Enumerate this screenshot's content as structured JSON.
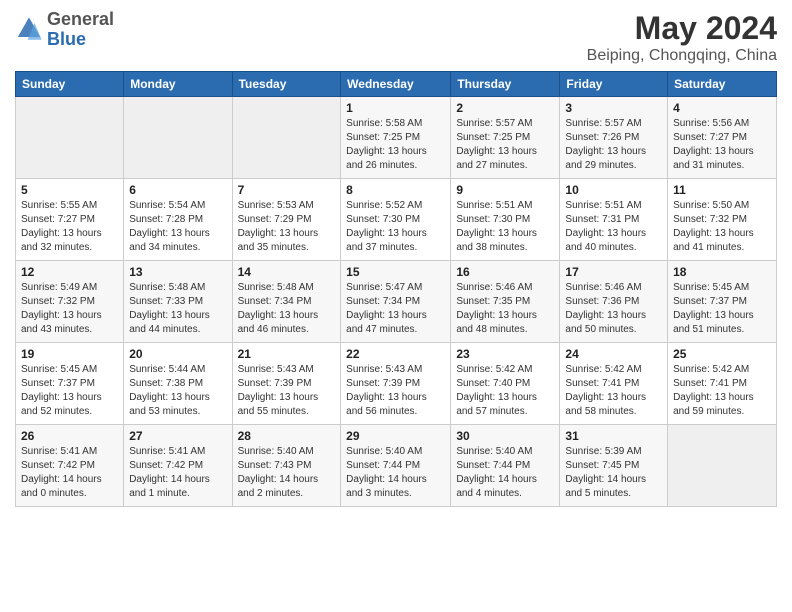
{
  "header": {
    "logo_line1": "General",
    "logo_line2": "Blue",
    "main_title": "May 2024",
    "subtitle": "Beiping, Chongqing, China"
  },
  "days_of_week": [
    "Sunday",
    "Monday",
    "Tuesday",
    "Wednesday",
    "Thursday",
    "Friday",
    "Saturday"
  ],
  "weeks": [
    [
      {
        "day": "",
        "empty": true
      },
      {
        "day": "",
        "empty": true
      },
      {
        "day": "",
        "empty": true
      },
      {
        "day": "1",
        "sunrise": "5:58 AM",
        "sunset": "7:25 PM",
        "daylight": "13 hours and 26 minutes."
      },
      {
        "day": "2",
        "sunrise": "5:57 AM",
        "sunset": "7:25 PM",
        "daylight": "13 hours and 27 minutes."
      },
      {
        "day": "3",
        "sunrise": "5:57 AM",
        "sunset": "7:26 PM",
        "daylight": "13 hours and 29 minutes."
      },
      {
        "day": "4",
        "sunrise": "5:56 AM",
        "sunset": "7:27 PM",
        "daylight": "13 hours and 31 minutes."
      }
    ],
    [
      {
        "day": "5",
        "sunrise": "5:55 AM",
        "sunset": "7:27 PM",
        "daylight": "13 hours and 32 minutes."
      },
      {
        "day": "6",
        "sunrise": "5:54 AM",
        "sunset": "7:28 PM",
        "daylight": "13 hours and 34 minutes."
      },
      {
        "day": "7",
        "sunrise": "5:53 AM",
        "sunset": "7:29 PM",
        "daylight": "13 hours and 35 minutes."
      },
      {
        "day": "8",
        "sunrise": "5:52 AM",
        "sunset": "7:30 PM",
        "daylight": "13 hours and 37 minutes."
      },
      {
        "day": "9",
        "sunrise": "5:51 AM",
        "sunset": "7:30 PM",
        "daylight": "13 hours and 38 minutes."
      },
      {
        "day": "10",
        "sunrise": "5:51 AM",
        "sunset": "7:31 PM",
        "daylight": "13 hours and 40 minutes."
      },
      {
        "day": "11",
        "sunrise": "5:50 AM",
        "sunset": "7:32 PM",
        "daylight": "13 hours and 41 minutes."
      }
    ],
    [
      {
        "day": "12",
        "sunrise": "5:49 AM",
        "sunset": "7:32 PM",
        "daylight": "13 hours and 43 minutes."
      },
      {
        "day": "13",
        "sunrise": "5:48 AM",
        "sunset": "7:33 PM",
        "daylight": "13 hours and 44 minutes."
      },
      {
        "day": "14",
        "sunrise": "5:48 AM",
        "sunset": "7:34 PM",
        "daylight": "13 hours and 46 minutes."
      },
      {
        "day": "15",
        "sunrise": "5:47 AM",
        "sunset": "7:34 PM",
        "daylight": "13 hours and 47 minutes."
      },
      {
        "day": "16",
        "sunrise": "5:46 AM",
        "sunset": "7:35 PM",
        "daylight": "13 hours and 48 minutes."
      },
      {
        "day": "17",
        "sunrise": "5:46 AM",
        "sunset": "7:36 PM",
        "daylight": "13 hours and 50 minutes."
      },
      {
        "day": "18",
        "sunrise": "5:45 AM",
        "sunset": "7:37 PM",
        "daylight": "13 hours and 51 minutes."
      }
    ],
    [
      {
        "day": "19",
        "sunrise": "5:45 AM",
        "sunset": "7:37 PM",
        "daylight": "13 hours and 52 minutes."
      },
      {
        "day": "20",
        "sunrise": "5:44 AM",
        "sunset": "7:38 PM",
        "daylight": "13 hours and 53 minutes."
      },
      {
        "day": "21",
        "sunrise": "5:43 AM",
        "sunset": "7:39 PM",
        "daylight": "13 hours and 55 minutes."
      },
      {
        "day": "22",
        "sunrise": "5:43 AM",
        "sunset": "7:39 PM",
        "daylight": "13 hours and 56 minutes."
      },
      {
        "day": "23",
        "sunrise": "5:42 AM",
        "sunset": "7:40 PM",
        "daylight": "13 hours and 57 minutes."
      },
      {
        "day": "24",
        "sunrise": "5:42 AM",
        "sunset": "7:41 PM",
        "daylight": "13 hours and 58 minutes."
      },
      {
        "day": "25",
        "sunrise": "5:42 AM",
        "sunset": "7:41 PM",
        "daylight": "13 hours and 59 minutes."
      }
    ],
    [
      {
        "day": "26",
        "sunrise": "5:41 AM",
        "sunset": "7:42 PM",
        "daylight": "14 hours and 0 minutes."
      },
      {
        "day": "27",
        "sunrise": "5:41 AM",
        "sunset": "7:42 PM",
        "daylight": "14 hours and 1 minute."
      },
      {
        "day": "28",
        "sunrise": "5:40 AM",
        "sunset": "7:43 PM",
        "daylight": "14 hours and 2 minutes."
      },
      {
        "day": "29",
        "sunrise": "5:40 AM",
        "sunset": "7:44 PM",
        "daylight": "14 hours and 3 minutes."
      },
      {
        "day": "30",
        "sunrise": "5:40 AM",
        "sunset": "7:44 PM",
        "daylight": "14 hours and 4 minutes."
      },
      {
        "day": "31",
        "sunrise": "5:39 AM",
        "sunset": "7:45 PM",
        "daylight": "14 hours and 5 minutes."
      },
      {
        "day": "",
        "empty": true
      }
    ]
  ],
  "labels": {
    "sunrise": "Sunrise:",
    "sunset": "Sunset:",
    "daylight": "Daylight:"
  }
}
